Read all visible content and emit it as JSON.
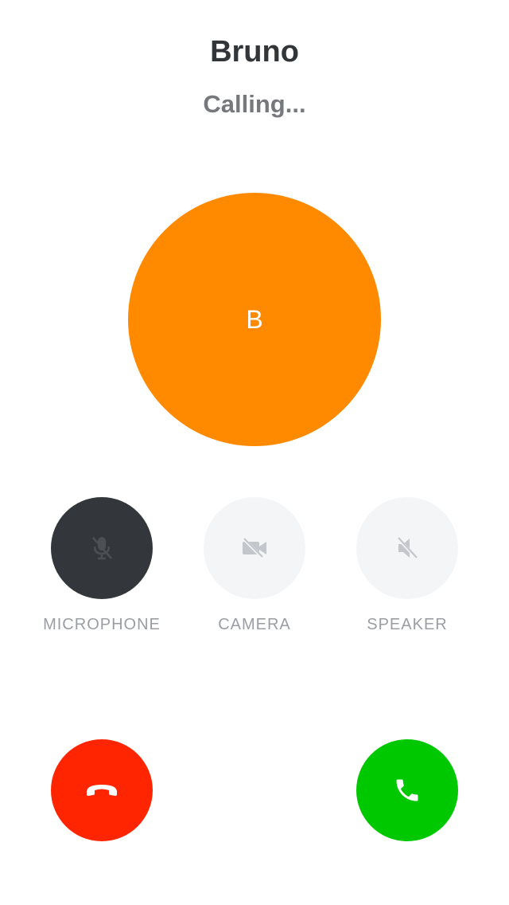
{
  "caller": {
    "name": "Bruno",
    "status": "Calling...",
    "initial": "B",
    "avatar_color": "#ff8a00"
  },
  "controls": [
    {
      "label": "MICROPHONE",
      "icon": "microphone-off-icon",
      "active": true
    },
    {
      "label": "CAMERA",
      "icon": "camera-off-icon",
      "active": false
    },
    {
      "label": "SPEAKER",
      "icon": "speaker-off-icon",
      "active": false
    }
  ],
  "actions": {
    "decline": {
      "icon": "hang-up-icon",
      "color": "#ff2500"
    },
    "accept": {
      "icon": "phone-icon",
      "color": "#00c800"
    }
  }
}
